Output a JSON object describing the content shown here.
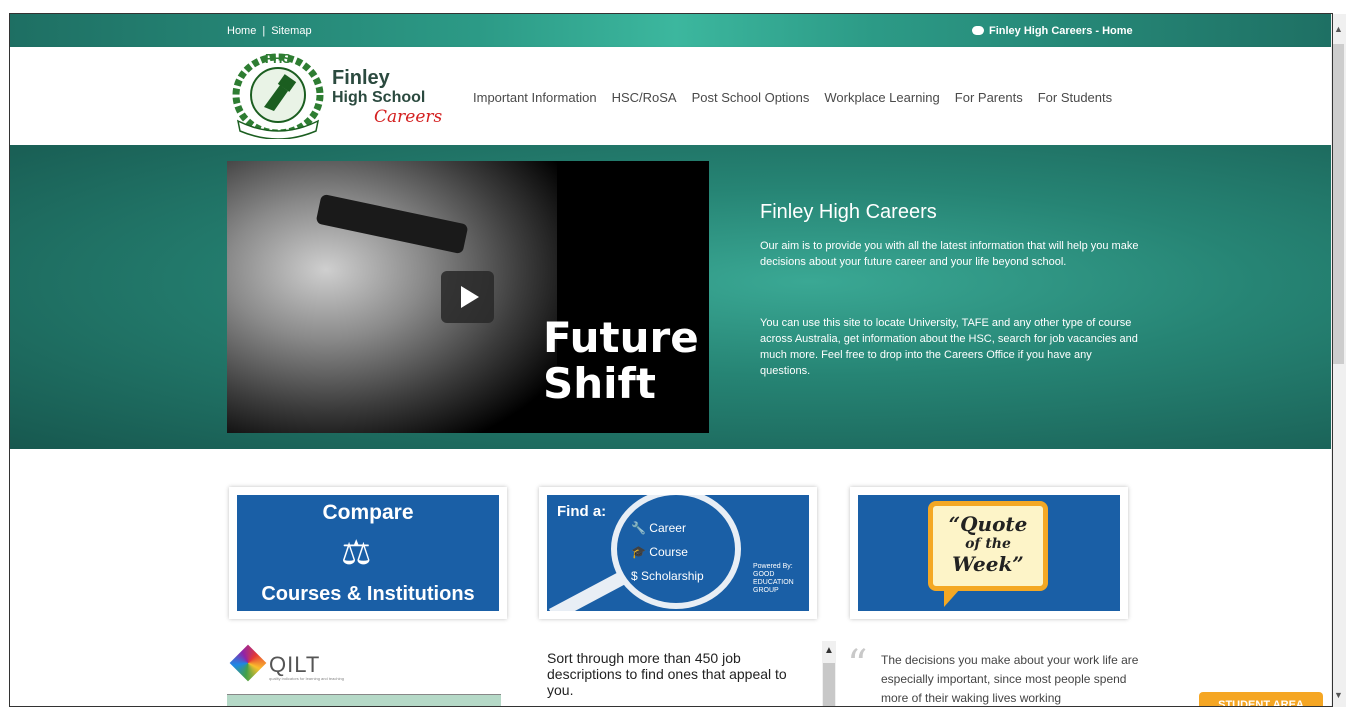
{
  "topbar": {
    "home": "Home",
    "sitemap": "Sitemap",
    "site_link": "Finley High Careers - Home"
  },
  "brand": {
    "line1": "Finley",
    "line2": "High School",
    "line3": "Careers",
    "logo_text": "FHS"
  },
  "nav": {
    "items": [
      "Important Information",
      "HSC/RoSA",
      "Post School Options",
      "Workplace Learning",
      "For Parents",
      "For Students"
    ]
  },
  "hero": {
    "video_title_1": "Future",
    "video_title_2": "Shift",
    "heading": "Finley High Careers",
    "para1": "Our aim is to provide you with all the latest information that will help you make decisions about your future career and your life beyond school.",
    "para2": "You can use this site to locate University, TAFE and any other type of course across Australia, get information about the HSC, search for job vacancies and much more. Feel free to drop into the Careers Office if you have any questions."
  },
  "tiles": {
    "compare_top": "Compare",
    "compare_bottom": "Courses & Institutions",
    "find_label": "Find a:",
    "find_items": [
      "Career",
      "Course",
      "Scholarship"
    ],
    "powered": "Powered By:",
    "powered_org": "GOOD EDUCATION GROUP",
    "quote_1": "“Quote",
    "quote_2": "of the",
    "quote_3": "Week”"
  },
  "bottom": {
    "qilt": "QILT",
    "qilt_sub": "quality indicators for learning and teaching",
    "sort_text": "Sort through more than 450 job descriptions to find ones that appeal to you.",
    "quote_text": "The decisions you make about your work life are especially important, since most people spend more of their waking lives working",
    "student_area": "STUDENT AREA"
  },
  "colors": {
    "teal": "#2c9a86",
    "tile_blue": "#1a5fa6",
    "accent_orange": "#f5a623"
  }
}
